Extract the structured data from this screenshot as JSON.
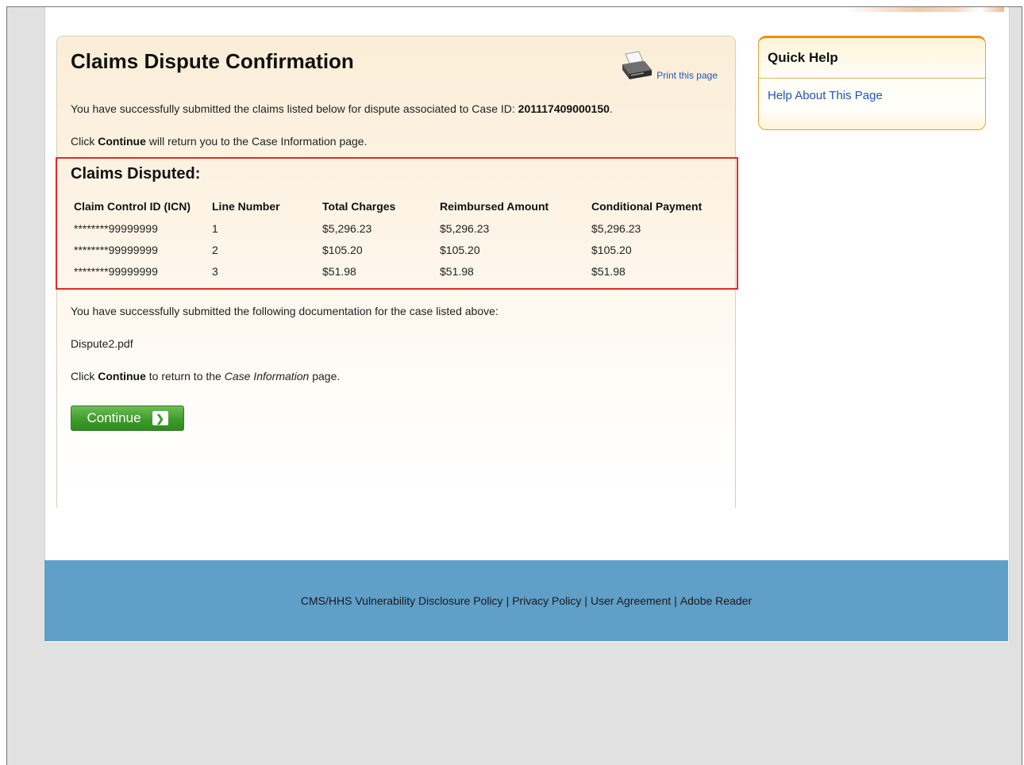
{
  "main": {
    "title": "Claims Dispute Confirmation",
    "print_label": "Print this page",
    "intro_text": "You have successfully submitted the claims listed below for dispute associated to Case ID: ",
    "case_id": "201117409000150",
    "intro_end": ".",
    "click_text": "Click ",
    "continue_word": "Continue",
    "will_return_text": " will return you to the Case Information page.",
    "claims_heading": "Claims Disputed:",
    "claims_columns": [
      "Claim Control ID (ICN)",
      "Line Number",
      "Total Charges",
      "Reimbursed Amount",
      "Conditional Payment"
    ],
    "claims_rows": [
      [
        "********99999999",
        "1",
        "$5,296.23",
        "$5,296.23",
        "$5,296.23"
      ],
      [
        "********99999999",
        "2",
        "$105.20",
        "$105.20",
        "$105.20"
      ],
      [
        "********99999999",
        "3",
        "$51.98",
        "$51.98",
        "$51.98"
      ]
    ],
    "docs_text": "You have successfully submitted the following documentation for the case listed above:",
    "doc_file": "Dispute2.pdf",
    "click_text2": "Click ",
    "to_return_text": " to return to the ",
    "case_info_italic": "Case Information",
    "page_end": " page.",
    "continue_button_label": "Continue",
    "printer_icon": "printer-icon",
    "arrow_icon": "arrow-right-icon"
  },
  "quick_help": {
    "title": "Quick Help",
    "link": "Help About This Page"
  },
  "footer": {
    "links": [
      "CMS/HHS Vulnerability Disclosure Policy",
      "Privacy Policy",
      "User Agreement",
      "Adobe Reader"
    ],
    "separator": "|"
  },
  "colors": {
    "footer_bg": "#5f9fc8",
    "highlight_border": "#e12a2a",
    "button_green": "#3f9c2c",
    "link_blue": "#1f56b3",
    "quick_help_border": "#e88f10"
  }
}
